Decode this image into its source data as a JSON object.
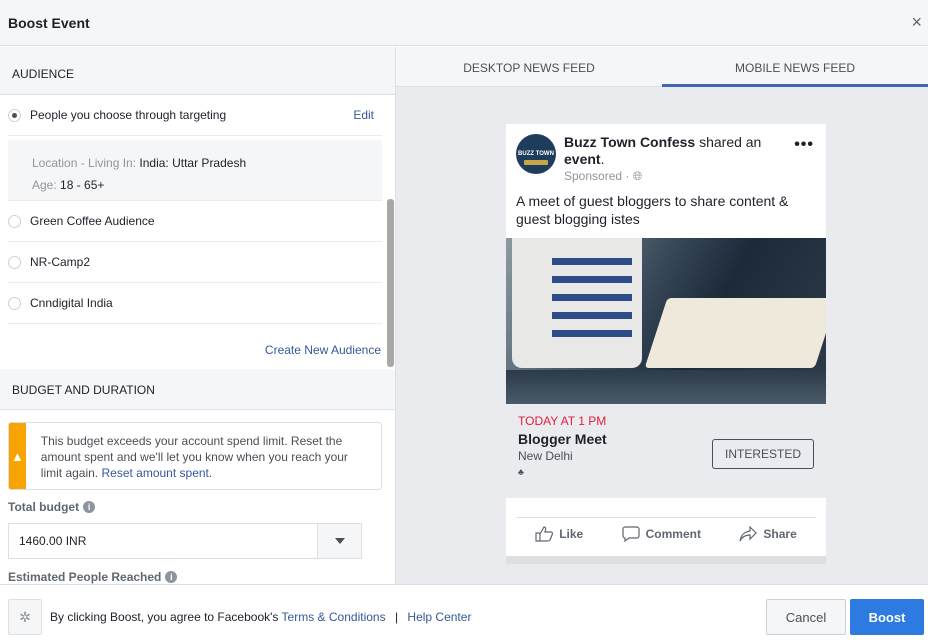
{
  "dialog": {
    "title": "Boost Event",
    "close_icon": "×"
  },
  "audience": {
    "heading": "AUDIENCE",
    "selected": {
      "label": "People you choose through targeting",
      "edit_label": "Edit"
    },
    "targeting": {
      "location_label": "Location - Living In:",
      "location_value": "India: Uttar Pradesh",
      "age_label": "Age:",
      "age_value": "18 - 65+"
    },
    "options": [
      {
        "label": "Green Coffee Audience"
      },
      {
        "label": "NR-Camp2"
      },
      {
        "label": "Cnndigital India"
      }
    ],
    "create_label": "Create New Audience"
  },
  "budget": {
    "heading": "BUDGET AND DURATION",
    "warning": {
      "icon": "warning-icon",
      "text": "This budget exceeds your account spend limit. Reset the amount spent and we'll let you know when you reach your limit again.",
      "link": "Reset amount spent."
    },
    "total_label": "Total budget",
    "total_value": "1460.00 INR",
    "reach_label": "Estimated People Reached"
  },
  "preview": {
    "tabs": [
      {
        "label": "DESKTOP NEWS FEED",
        "active": false
      },
      {
        "label": "MOBILE NEWS FEED",
        "active": true
      }
    ],
    "accent": "#4267b2",
    "post": {
      "page_name": "Buzz Town Confess",
      "shared_text": "shared an",
      "object": "event",
      "sponsored": "Sponsored ·",
      "avatar_text": "BUZZ TOWN",
      "body": "A meet of guest bloggers to share content & guest blogging istes",
      "event": {
        "date": "TODAY AT 1 PM",
        "name": "Blogger Meet",
        "location": "New Delhi",
        "button": "INTERESTED"
      },
      "actions": [
        "Like",
        "Comment",
        "Share"
      ]
    }
  },
  "footer": {
    "agree_text": "By clicking Boost, you agree to Facebook's",
    "terms_link": "Terms & Conditions",
    "separator": "|",
    "help_link": "Help Center",
    "cancel_label": "Cancel",
    "boost_label": "Boost"
  }
}
